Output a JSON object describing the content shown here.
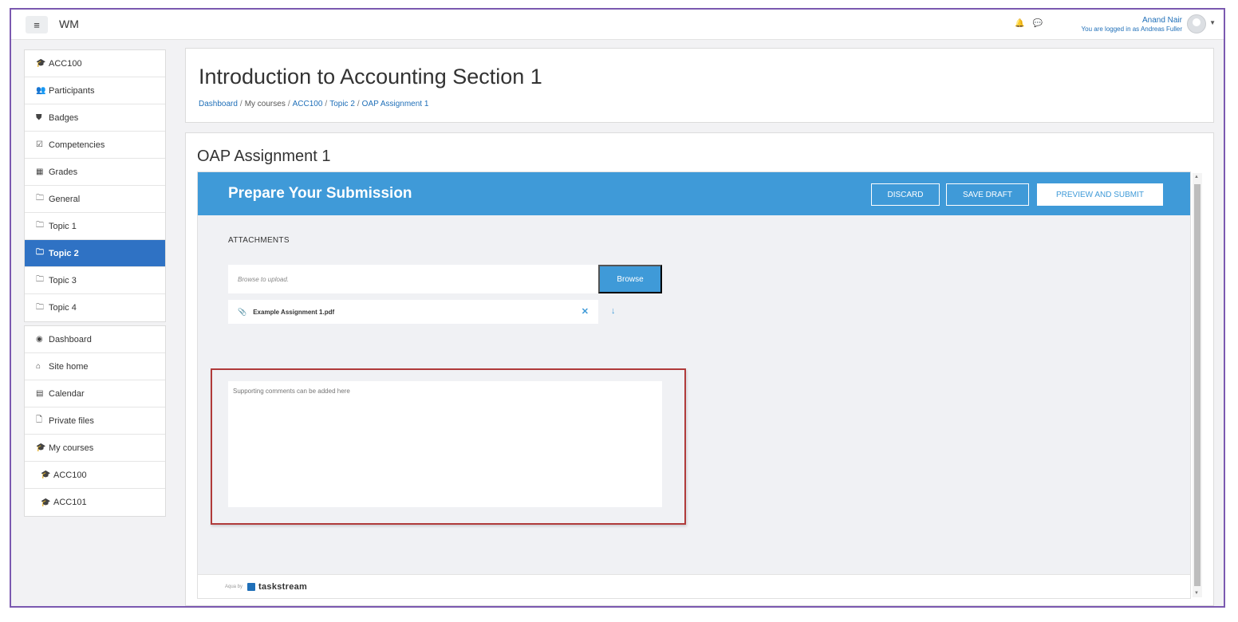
{
  "navbar": {
    "menu_icon": "hamburger-icon",
    "brand": "WM",
    "notification_icon": "bell-icon",
    "message_icon": "chat-bubble-icon",
    "user_name": "Anand Nair",
    "logged_in_as": "You are logged in as Andreas Fuller"
  },
  "sidebar": {
    "groups": [
      [
        {
          "label": "ACC100",
          "icon": "graduation-cap-icon",
          "glyph": "🎓"
        },
        {
          "label": "Participants",
          "icon": "users-icon",
          "glyph": "👥"
        },
        {
          "label": "Badges",
          "icon": "shield-icon",
          "glyph": "⛊"
        },
        {
          "label": "Competencies",
          "icon": "checkbox-icon",
          "glyph": "☑"
        },
        {
          "label": "Grades",
          "icon": "table-icon",
          "glyph": "▦"
        },
        {
          "label": "General",
          "icon": "folder-icon",
          "glyph": "🗀"
        },
        {
          "label": "Topic 1",
          "icon": "folder-icon",
          "glyph": "🗀"
        },
        {
          "label": "Topic 2",
          "icon": "folder-icon",
          "glyph": "🗀",
          "active": true
        },
        {
          "label": "Topic 3",
          "icon": "folder-icon",
          "glyph": "🗀"
        },
        {
          "label": "Topic 4",
          "icon": "folder-icon",
          "glyph": "🗀"
        }
      ],
      [
        {
          "label": "Dashboard",
          "icon": "dashboard-icon",
          "glyph": "◉"
        },
        {
          "label": "Site home",
          "icon": "home-icon",
          "glyph": "⌂"
        },
        {
          "label": "Calendar",
          "icon": "calendar-icon",
          "glyph": "▤"
        },
        {
          "label": "Private files",
          "icon": "file-icon",
          "glyph": "🗋"
        },
        {
          "label": "My courses",
          "icon": "graduation-cap-icon",
          "glyph": "🎓"
        },
        {
          "label": "ACC100",
          "icon": "graduation-cap-icon",
          "glyph": "🎓",
          "indent": true
        },
        {
          "label": "ACC101",
          "icon": "graduation-cap-icon",
          "glyph": "🎓",
          "indent": true
        }
      ]
    ]
  },
  "header": {
    "title": "Introduction to Accounting Section 1",
    "breadcrumb": [
      "Dashboard",
      "My courses",
      "ACC100",
      "Topic 2",
      "OAP Assignment 1"
    ]
  },
  "main": {
    "assignment_title": "OAP Assignment 1",
    "aqua": {
      "title": "Prepare Your Submission",
      "discard": "DISCARD",
      "save_draft": "SAVE DRAFT",
      "preview_submit": "PREVIEW AND SUBMIT",
      "attachments_label": "ATTACHMENTS",
      "upload_placeholder": "Browse to upload.",
      "browse": "Browse",
      "file_name": "Example Assignment 1.pdf",
      "comments_placeholder": "Supporting comments can be added here",
      "footer_by": "Aqua by",
      "footer_brand": "taskstream"
    }
  },
  "colors": {
    "accent": "#3f9ad8",
    "active_nav": "#2f72c4",
    "frame_border": "#7b59b0",
    "highlight": "#b03a3a"
  }
}
